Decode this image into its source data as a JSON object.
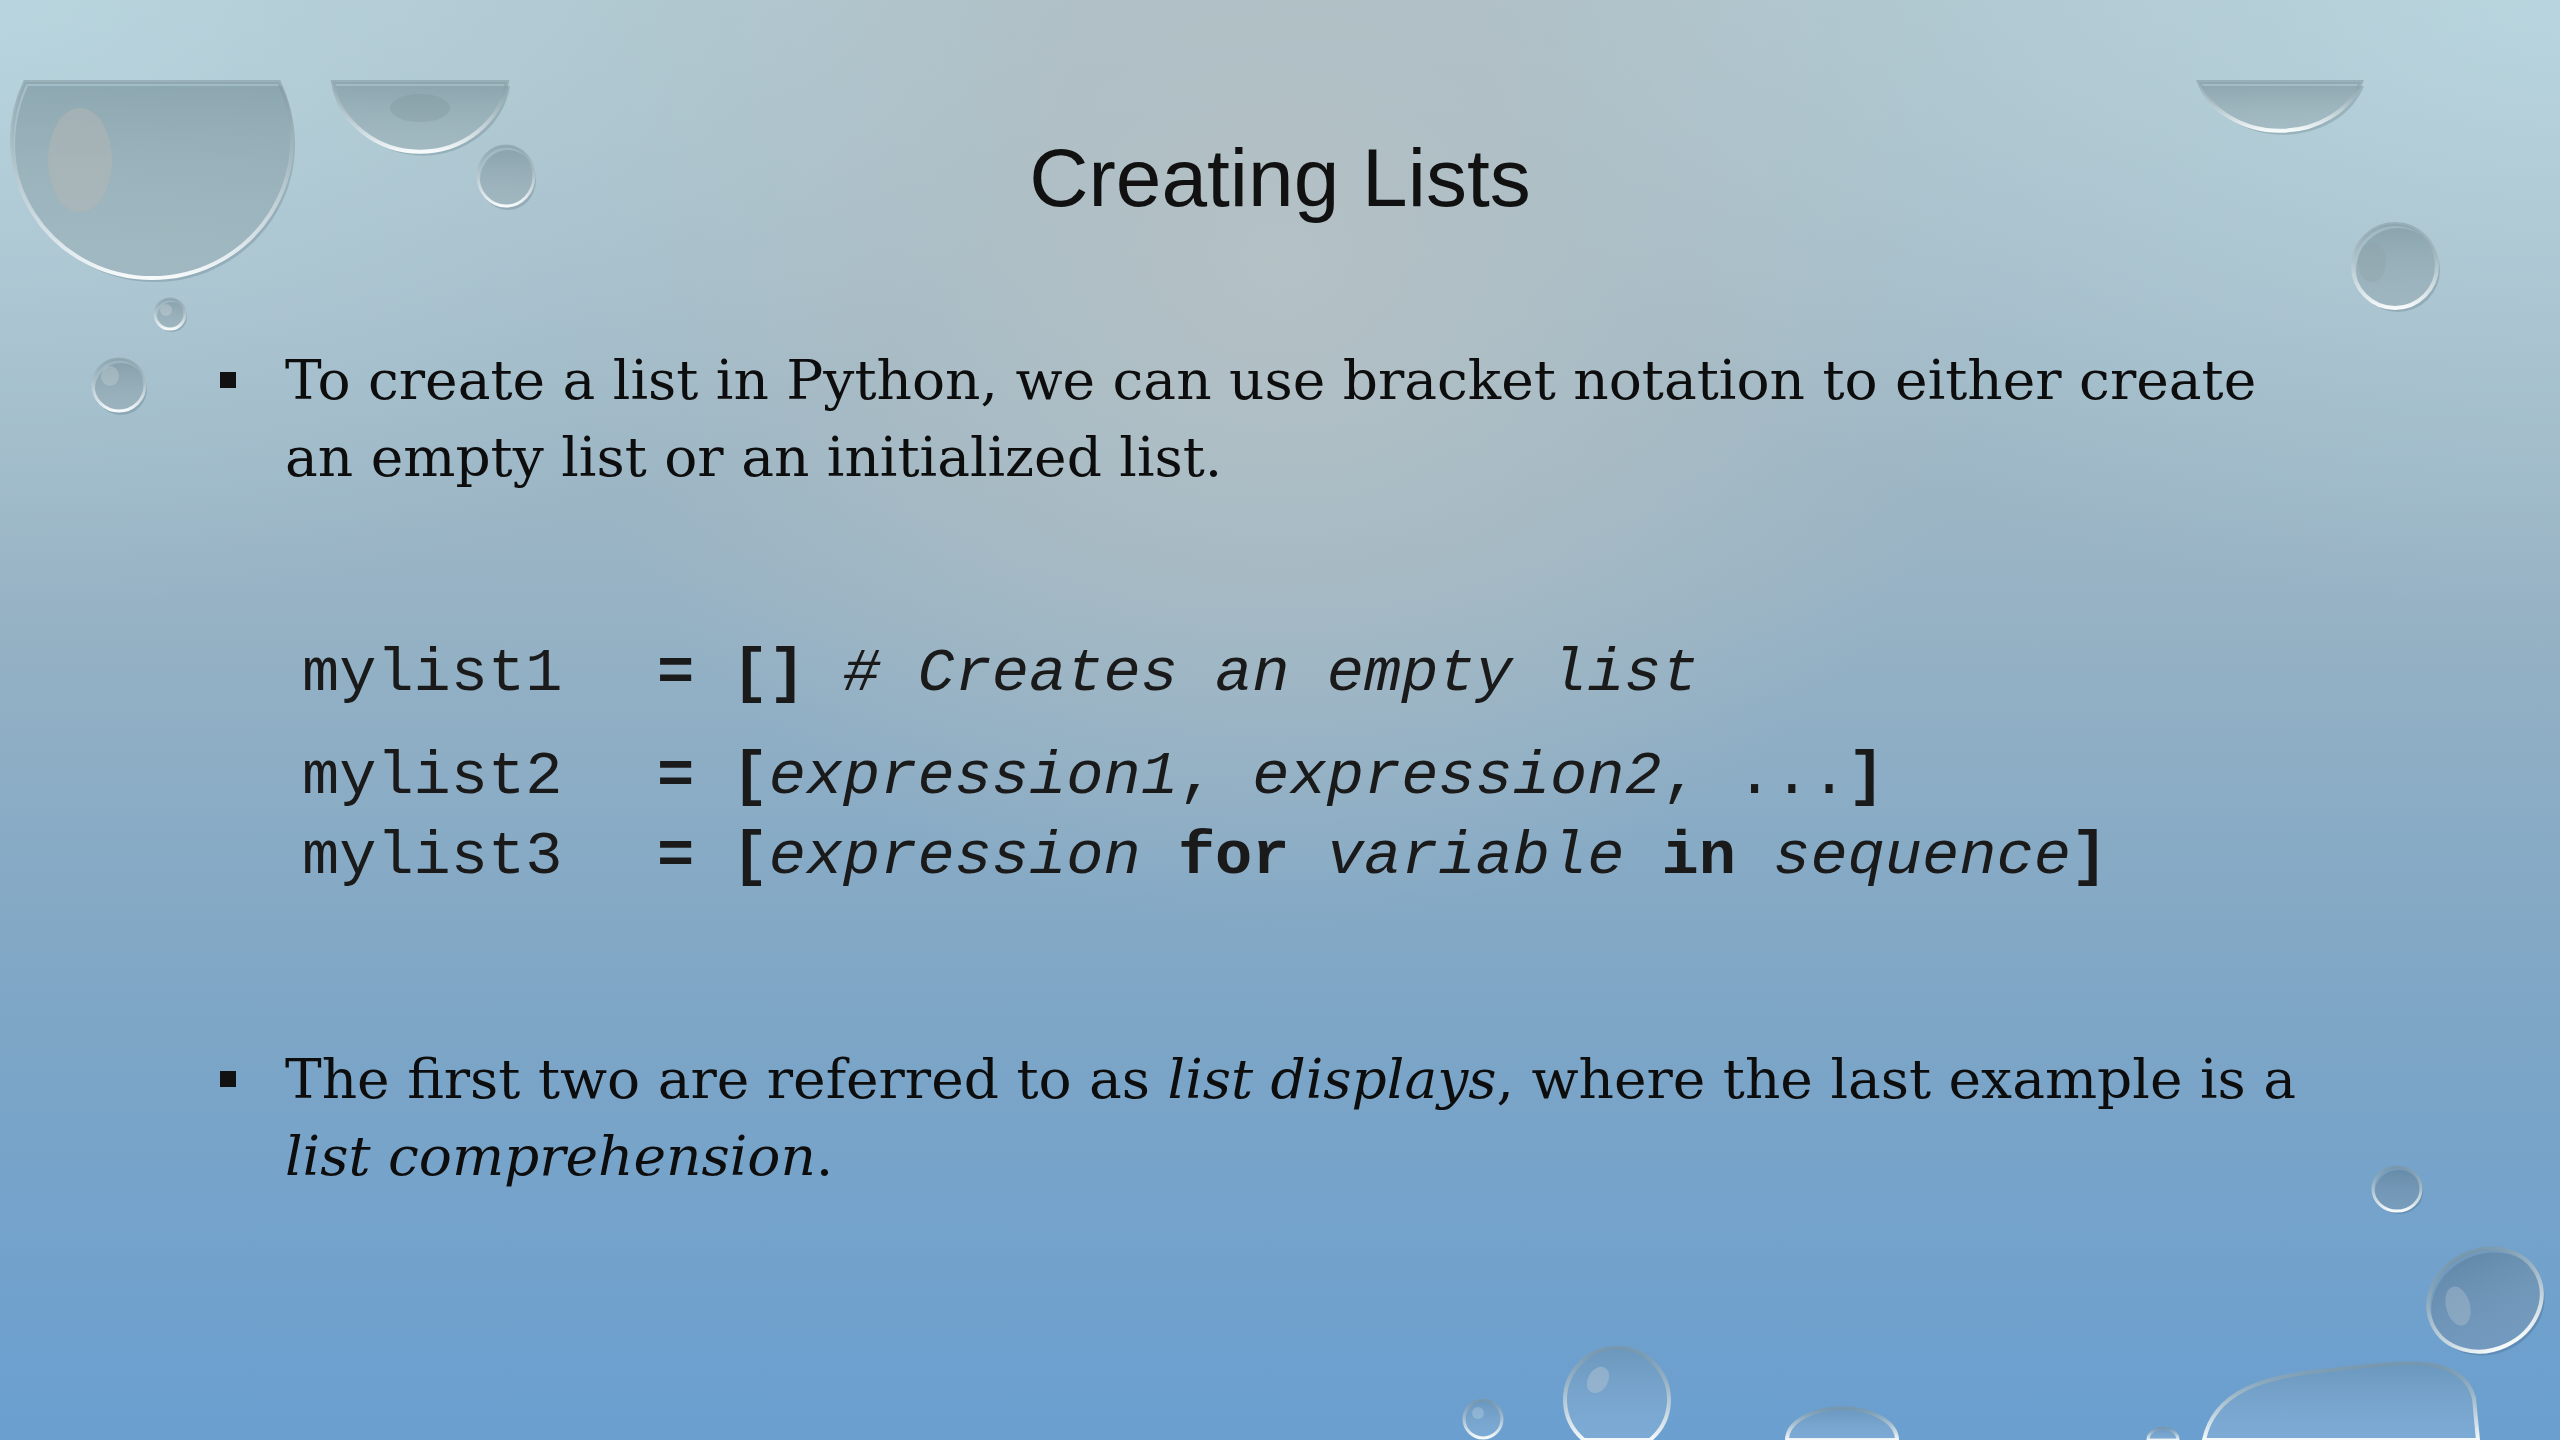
{
  "slide": {
    "title": "Creating Lists",
    "content": [
      {
        "kind": "bullet",
        "text": "To create a list in Python, we can use bracket notation to either create an empty list or an initialized list."
      },
      {
        "kind": "code",
        "lines": [
          {
            "name": "mylist1",
            "parts": [
              {
                "kind": "bold",
                "text": "= []"
              },
              {
                "kind": "italic",
                "text": " # Creates an empty list"
              }
            ]
          }
        ]
      },
      {
        "kind": "code",
        "lines": [
          {
            "name": "mylist2",
            "parts": [
              {
                "kind": "bold",
                "text": "= ["
              },
              {
                "kind": "italic",
                "text": "expression1"
              },
              {
                "kind": "plain",
                "text": ", "
              },
              {
                "kind": "italic",
                "text": "expression2"
              },
              {
                "kind": "plain",
                "text": ", ..."
              },
              {
                "kind": "bold",
                "text": "]"
              }
            ]
          },
          {
            "name": "mylist3",
            "parts": [
              {
                "kind": "bold",
                "text": "= ["
              },
              {
                "kind": "italic",
                "text": "expression"
              },
              {
                "kind": "bold",
                "text": " for "
              },
              {
                "kind": "italic",
                "text": "variable"
              },
              {
                "kind": "bold",
                "text": " in "
              },
              {
                "kind": "italic",
                "text": "sequence"
              },
              {
                "kind": "bold",
                "text": "]"
              }
            ]
          }
        ]
      },
      {
        "kind": "bullet",
        "text": "The first two are referred to as *list displays*, where the last example is a *list comprehension*."
      }
    ]
  }
}
